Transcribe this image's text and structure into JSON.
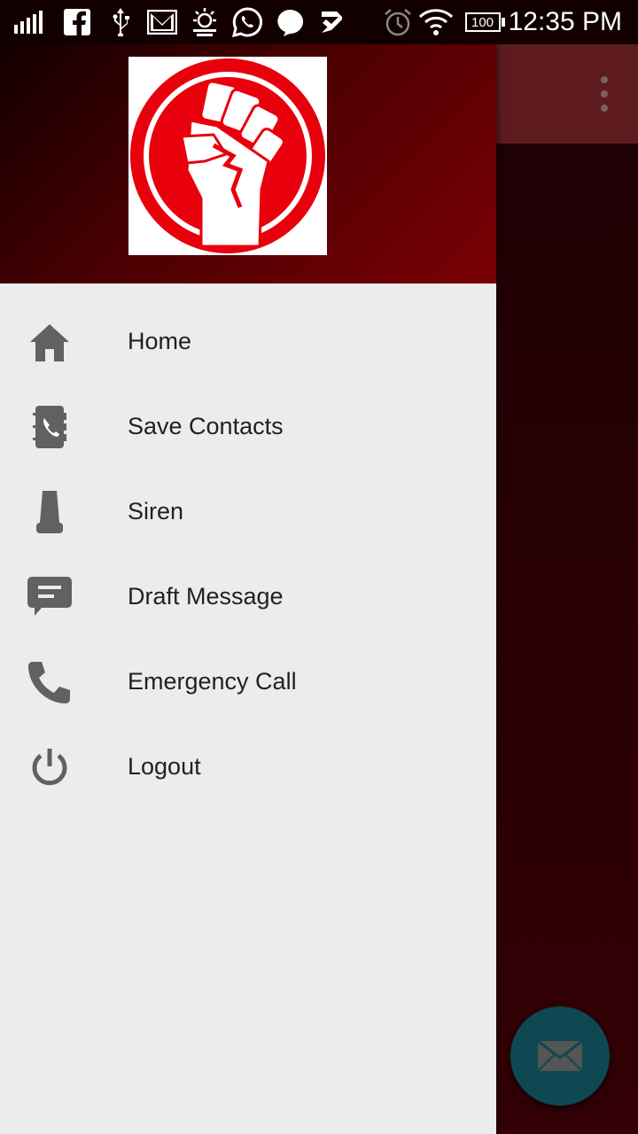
{
  "status_bar": {
    "time": "12:35 PM",
    "battery": "100",
    "icons": [
      "signal-icon",
      "facebook-icon",
      "usb-icon",
      "gmail-icon",
      "sun-icon",
      "whatsapp-icon",
      "chat-bubble-icon",
      "check-icon",
      "alarm-icon",
      "wifi-icon",
      "battery-icon"
    ]
  },
  "drawer": {
    "logo_icon": "raised-fist-logo",
    "items": [
      {
        "label": "Home",
        "icon": "home-icon"
      },
      {
        "label": "Save Contacts",
        "icon": "contacts-book-icon"
      },
      {
        "label": "Siren",
        "icon": "siren-icon"
      },
      {
        "label": "Draft Message",
        "icon": "message-icon"
      },
      {
        "label": "Emergency Call",
        "icon": "phone-icon"
      },
      {
        "label": "Logout",
        "icon": "power-icon"
      }
    ]
  },
  "app": {
    "overflow_icon": "more-vert-icon",
    "fab_icon": "email-icon"
  },
  "colors": {
    "header_accent": "#7a0004",
    "drawer_bg": "#ececec",
    "icon_gray": "#616161",
    "fab": "#0f4752",
    "logo_red": "#e8000c"
  }
}
